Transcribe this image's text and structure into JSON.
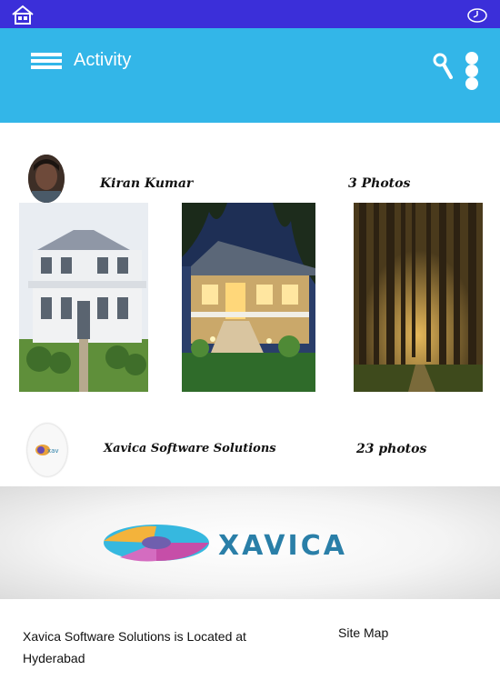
{
  "statusbar": {
    "home_icon": "home-icon",
    "clock_icon": "clock-icon"
  },
  "appbar": {
    "title": "Activity",
    "menu_icon": "menu-icon",
    "search_icon": "search-icon",
    "more_icon": "more-vertical-icon"
  },
  "feed": [
    {
      "name": "Kiran Kumar",
      "count": "3 Photos",
      "photos": [
        "colonial-house-photo",
        "lit-cottage-photo",
        "forest-photo"
      ]
    },
    {
      "name": "Xavica Software Solutions",
      "count": "23 photos",
      "logo": "XAVICA"
    }
  ],
  "footer": {
    "text": "Xavica Software Solutions is Located at Hyderabad",
    "link": "Site Map"
  },
  "colors": {
    "status_bar": "#3b2fd9",
    "app_bar": "#33b6e8",
    "logo_text": "#2a7fa8"
  }
}
